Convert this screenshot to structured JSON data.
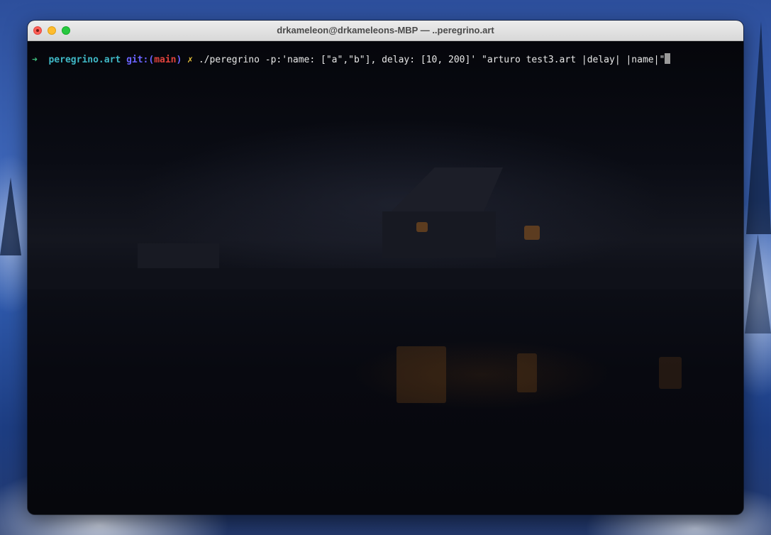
{
  "window": {
    "title": "drkameleon@drkameleons-MBP — ..peregrino.art"
  },
  "terminal": {
    "prompt_symbol": "➜",
    "directory": "peregrino.art",
    "git_prefix": "git:(",
    "branch": "main",
    "git_suffix": ")",
    "dirty_marker": "✗",
    "command": "./peregrino -p:'name: [\"a\",\"b\"], delay: [10, 200]' \"arturo test3.art |delay| |name|\""
  }
}
